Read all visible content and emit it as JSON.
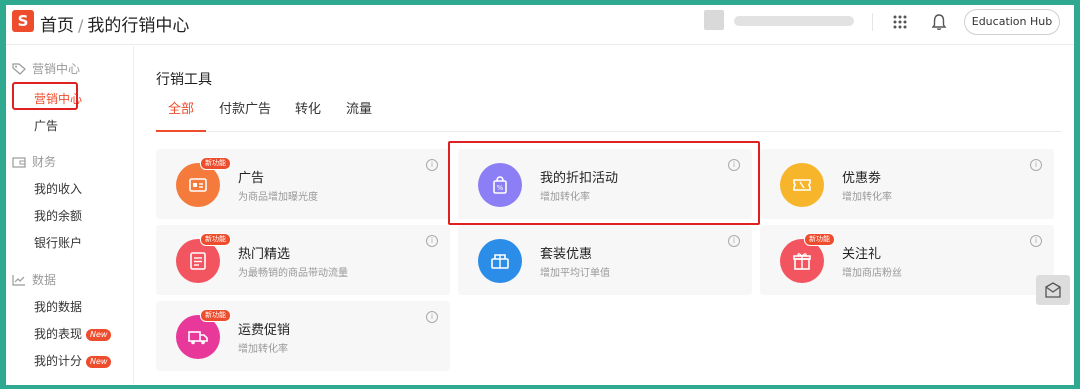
{
  "header": {
    "logo_letter": "S",
    "breadcrumb_home": "首页",
    "breadcrumb_sep": "/",
    "breadcrumb_current": "我的行销中心",
    "education_hub_label": "Education Hub"
  },
  "sidebar": {
    "groups": [
      {
        "label": "营销中心",
        "icon": "tag-icon",
        "items": [
          {
            "label": "营销中心",
            "active": true
          },
          {
            "label": "广告"
          }
        ]
      },
      {
        "label": "财务",
        "icon": "wallet-icon",
        "items": [
          {
            "label": "我的收入"
          },
          {
            "label": "我的余额"
          },
          {
            "label": "银行账户"
          }
        ]
      },
      {
        "label": "数据",
        "icon": "chart-icon",
        "items": [
          {
            "label": "我的数据"
          },
          {
            "label": "我的表现",
            "badge": "New"
          },
          {
            "label": "我的计分",
            "badge": "New"
          }
        ]
      }
    ]
  },
  "main": {
    "title": "行销工具",
    "tabs": [
      {
        "label": "全部",
        "active": true
      },
      {
        "label": "付款广告"
      },
      {
        "label": "转化"
      },
      {
        "label": "流量"
      }
    ],
    "cards": [
      {
        "title": "广告",
        "desc": "为商品增加曝光度",
        "tag": "新功能",
        "color": "#f47b3b",
        "icon": "ad-icon"
      },
      {
        "title": "我的折扣活动",
        "desc": "增加转化率",
        "color": "#8c7ff5",
        "icon": "discount-bag-icon"
      },
      {
        "title": "优惠劵",
        "desc": "增加转化率",
        "color": "#f7b52b",
        "icon": "coupon-icon"
      },
      {
        "title": "热门精选",
        "desc": "为最畅销的商品带动流量",
        "tag": "新功能",
        "color": "#f25560",
        "icon": "top-picks-icon"
      },
      {
        "title": "套装优惠",
        "desc": "增加平均订单值",
        "color": "#2b8de8",
        "icon": "bundle-icon"
      },
      {
        "title": "关注礼",
        "desc": "增加商店粉丝",
        "tag": "新功能",
        "color": "#f25560",
        "icon": "gift-icon"
      },
      {
        "title": "运费促销",
        "desc": "增加转化率",
        "tag": "新功能",
        "color": "#e8399b",
        "icon": "truck-icon"
      }
    ],
    "info_glyph": "i"
  },
  "colors": {
    "brand": "#ee4d2d",
    "frame": "#2fa98f",
    "highlight": "#e02020"
  }
}
